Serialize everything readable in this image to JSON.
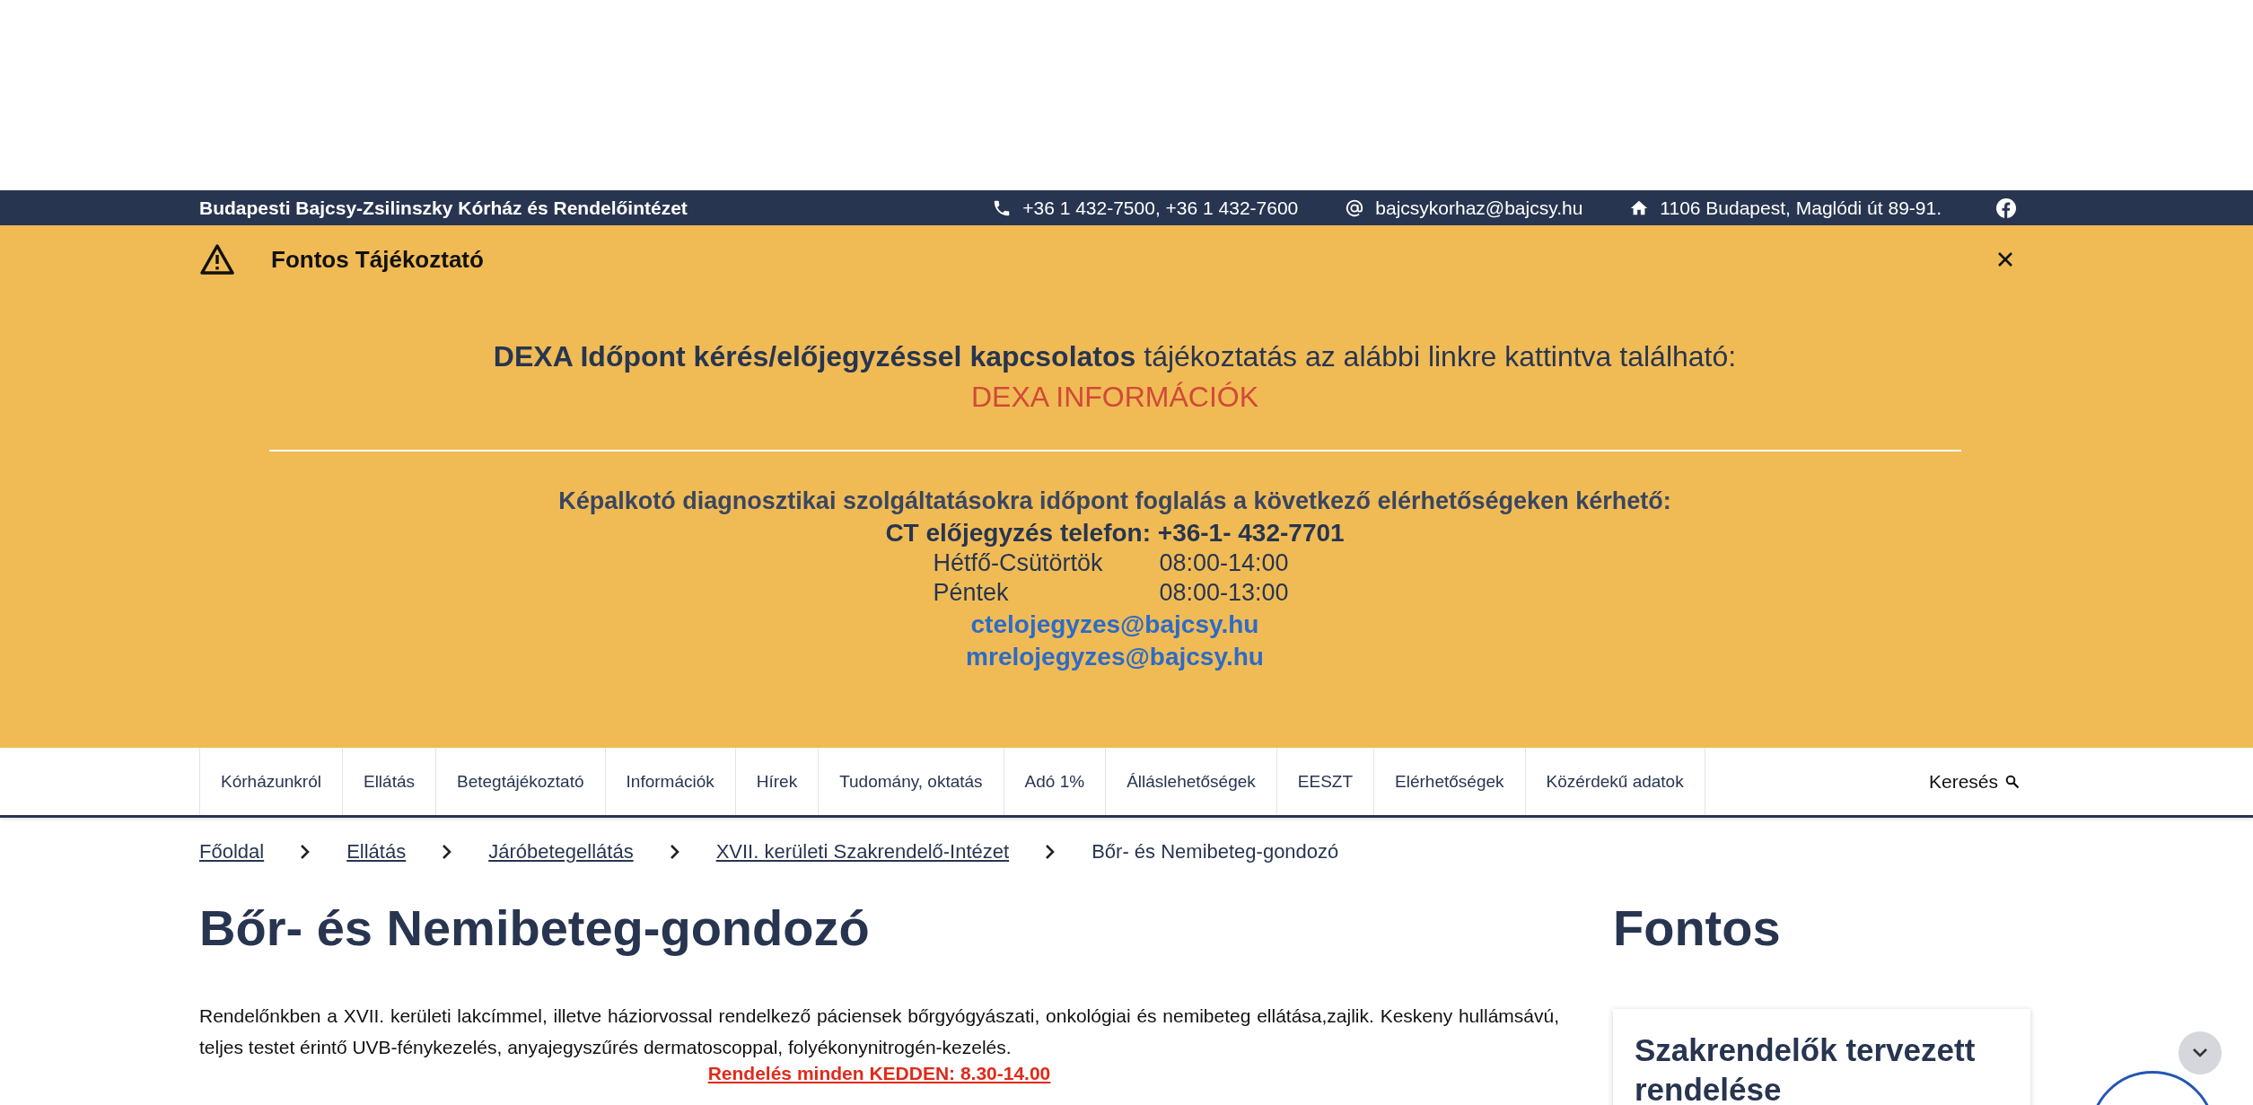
{
  "topbar": {
    "org": "Budapesti Bajcsy-Zsilinszky Kórház és Rendelőintézet",
    "phone": "+36 1 432-7500, +36 1 432-7600",
    "email": "bajcsykorhaz@bajcsy.hu",
    "address": "1106 Budapest, Maglódi út 89-91."
  },
  "notice": {
    "title": "Fontos Tájékoztató",
    "headline": "**DEXA Időpont kérés/előjegyzéssel kapcsolatos** tájékoztatás az alábbi linkre kattintva található:",
    "link": "DEXA INFORMÁCIÓK",
    "intro": "Képalkotó diagnosztikai szolgáltatásokra időpont foglalás a következő elérhetőségeken kérhető:",
    "phone_line": "CT előjegyzés telefon: +36-1- 432-7701",
    "hours": [
      {
        "days": "Hétfő-Csütörtök",
        "time": "08:00-14:00"
      },
      {
        "days": "Péntek",
        "time": "08:00-13:00"
      }
    ],
    "emails": [
      "ctelojegyzes@bajcsy.hu",
      "mrelojegyzes@bajcsy.hu"
    ]
  },
  "nav": {
    "items": [
      "Kórházunkról",
      "Ellátás",
      "Betegtájékoztató",
      "Információk",
      "Hírek",
      "Tudomány, oktatás",
      "Adó 1%",
      "Álláslehetőségek",
      "EESZT",
      "Elérhetőségek",
      "Közérdekű adatok"
    ],
    "search": "Keresés"
  },
  "breadcrumb": [
    {
      "label": "Főoldal",
      "kind": "link"
    },
    {
      "label": "Ellátás",
      "kind": "link"
    },
    {
      "label": "Járóbetegellátás",
      "kind": "link"
    },
    {
      "label": "XVII. kerületi Szakrendelő-Intézet",
      "kind": "link"
    },
    {
      "label": "Bőr- és Nemibeteg-gondozó",
      "kind": "current"
    }
  ],
  "page": {
    "title": "Bőr- és Nemibeteg-gondozó",
    "paragraph": "Rendelőnkben a XVII. kerületi lakcímmel, illetve háziorvossal rendelkező páciensek bőrgyógyászati, onkológiai és nemibeteg ellátása,zajlik. Keskeny hullámsávú, teljes testet érintő UVB-fénykezelés, anyajegyszűrés dermatoscoppal, folyékonynitrogén-kezelés.",
    "schedule": "Rendelés minden KEDDEN: 8.30-14.00"
  },
  "sidebar": {
    "title": "Fontos",
    "card_title": "Szakrendelők tervezett rendelése"
  }
}
